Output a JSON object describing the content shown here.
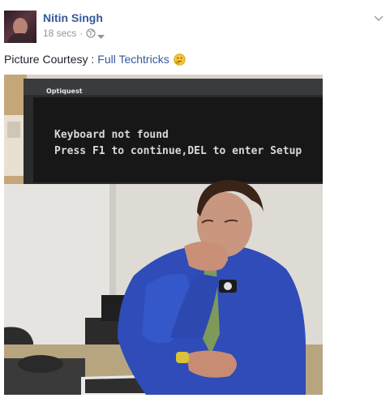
{
  "post": {
    "author": "Nitin Singh",
    "time": "18 secs",
    "separator": "·",
    "caption_prefix": "Picture Courtesy :",
    "caption_link": "Full Techtricks"
  },
  "photo": {
    "monitor_brand": "Optiquest",
    "screen_line1": "Keyboard not found",
    "screen_line2": "Press F1 to continue,DEL to enter Setup"
  },
  "icons": {
    "audience": "globe-icon",
    "audience_menu": "caret-down-icon",
    "post_menu": "chevron-down-icon",
    "emoji": "thinking-emoji-icon"
  },
  "colors": {
    "link": "#365899",
    "meta": "#90949c",
    "text": "#1d2129"
  }
}
